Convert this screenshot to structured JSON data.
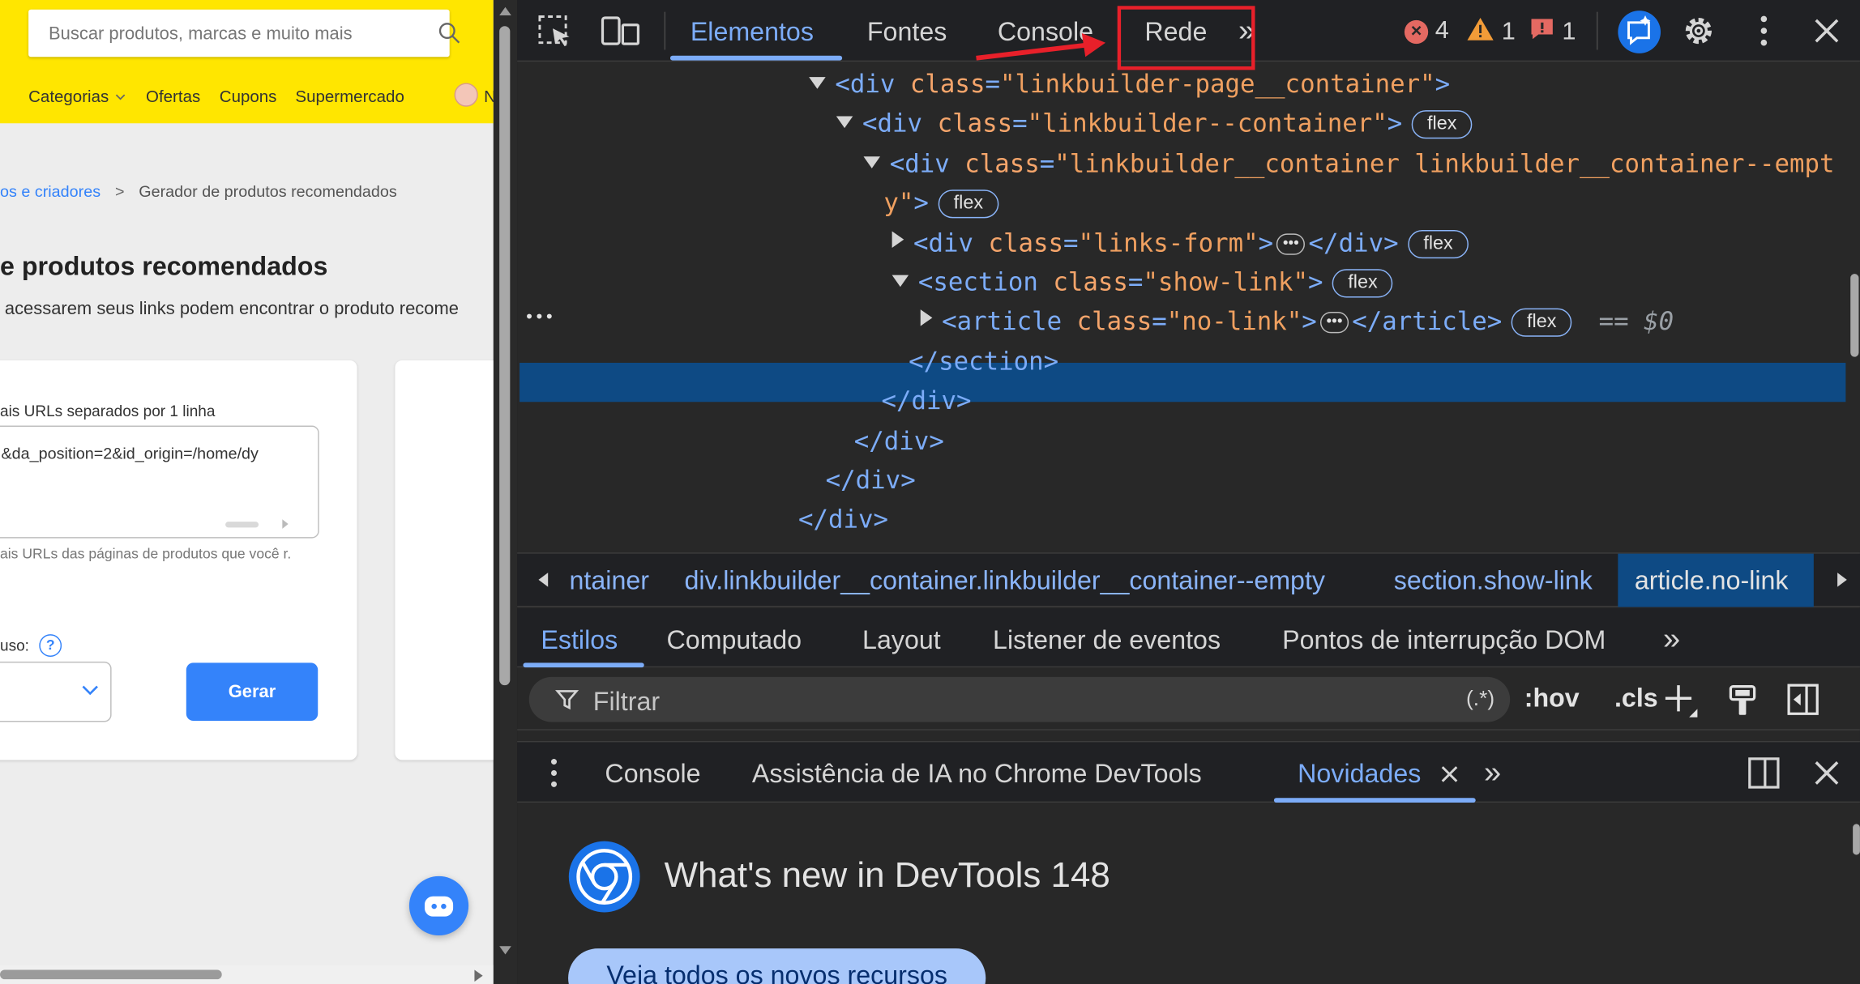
{
  "site": {
    "search_placeholder": "Buscar produtos, marcas e muito mais",
    "nav": [
      "Categorias",
      "Ofertas",
      "Cupons",
      "Supermercado"
    ],
    "user_initial": "N",
    "breadcrumb": {
      "link": "os e criadores",
      "separator": ">",
      "current": "Gerador de produtos recomendados"
    },
    "page_title": "e produtos recomendados",
    "page_subtitle": "acessarem seus links podem encontrar o produto recome",
    "form": {
      "urls_label": "ais URLs separados por 1 linha",
      "urls_value": "&da_position=2&id_origin=/home/dy",
      "urls_help": "ais URLs das páginas de produtos que você r.",
      "usage_label": "uso:",
      "help_mark": "?",
      "generate_label": "Gerar"
    }
  },
  "devtools": {
    "tabs": [
      "Elementos",
      "Fontes",
      "Console",
      "Rede"
    ],
    "active_tab": "Elementos",
    "more_tabs": "»",
    "status": {
      "errors": "4",
      "warnings": "1",
      "issues": "1"
    },
    "dom_lines": [
      {
        "indent": 246,
        "toggle": "down",
        "tag_open": "<div",
        "attr": "class",
        "value": "\"linkbuilder-page__container\"",
        "close": ">",
        "badge": ""
      },
      {
        "indent": 269,
        "toggle": "down",
        "tag_open": "<div",
        "attr": "class",
        "value": "\"linkbuilder--container\"",
        "close": ">",
        "badge": "flex"
      },
      {
        "indent": 292,
        "toggle": "down",
        "tag_open": "<div",
        "attr": "class",
        "value": "\"linkbuilder__container linkbuilder__container--empt",
        "close": "",
        "badge": ""
      },
      {
        "indent": 309,
        "toggle": "",
        "tag_open": "",
        "attr": "",
        "value": "y\"",
        "close": ">",
        "badge": "flex"
      },
      {
        "indent": 316,
        "toggle": "right",
        "tag_open": "<div",
        "attr": "class",
        "value": "\"links-form\"",
        "close": "></div>",
        "badge": "flex",
        "ellipsis": true
      },
      {
        "indent": 316,
        "toggle": "down",
        "tag_open": "<section",
        "attr": "class",
        "value": "\"show-link\"",
        "close": ">",
        "badge": "flex"
      },
      {
        "indent": 340,
        "toggle": "right",
        "tag_open": "<article",
        "attr": "class",
        "value": "\"no-link\"",
        "close": "></article>",
        "badge": "flex",
        "ellipsis": true,
        "selected": true,
        "suffix": "== $0"
      },
      {
        "indent": 330,
        "toggle": "",
        "tag_open": "</section>",
        "attr": "",
        "value": "",
        "close": "",
        "badge": ""
      },
      {
        "indent": 307,
        "toggle": "",
        "tag_open": "</div>",
        "attr": "",
        "value": "",
        "close": "",
        "badge": ""
      },
      {
        "indent": 284,
        "toggle": "",
        "tag_open": "</div>",
        "attr": "",
        "value": "",
        "close": "",
        "badge": ""
      },
      {
        "indent": 260,
        "toggle": "",
        "tag_open": "</div>",
        "attr": "",
        "value": "",
        "close": "",
        "badge": ""
      },
      {
        "indent": 237,
        "toggle": "",
        "tag_open": "</div>",
        "attr": "",
        "value": "",
        "close": "",
        "badge": ""
      }
    ],
    "row_dots": "•••",
    "crumbs": [
      "ntainer",
      "div.linkbuilder__container.linkbuilder__container--empty",
      "section.show-link",
      "article.no-link"
    ],
    "styles_tabs": [
      "Estilos",
      "Computado",
      "Layout",
      "Listener de eventos",
      "Pontos de interrupção DOM"
    ],
    "filter": {
      "placeholder": "Filtrar",
      "regex": "(.*)",
      "hov": ":hov",
      "cls": ".cls"
    },
    "drawer_tabs": [
      "Console",
      "Assistência de IA no Chrome DevTools",
      "Novidades"
    ],
    "whats_new": {
      "title": "What's new in DevTools 148",
      "button": "Veja todos os novos recursos"
    },
    "colors": {
      "accent": "#7cacf8",
      "selected_row": "#0e4a84",
      "annotation": "#e8202a"
    }
  }
}
